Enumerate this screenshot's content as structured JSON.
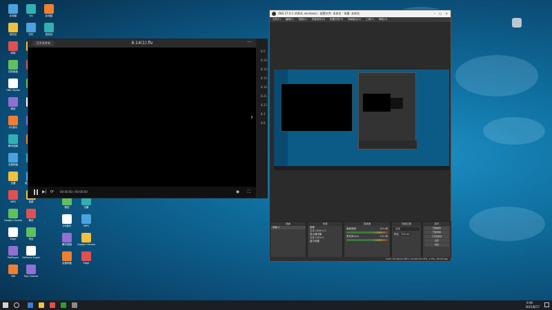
{
  "player": {
    "tab_label": "打开文件夹",
    "title": "8.14(1).flv",
    "time": "00:00:00 / 00:00:00",
    "side_list": [
      "8.5",
      "8.14",
      "8.14",
      "8.15",
      "8.16",
      "8.21",
      "8.22",
      "8.3",
      "8.6"
    ]
  },
  "obs": {
    "title": "OBS 27.0.1 (64bit, windows) - 配置文件: 未命名 - 场景: 未命名",
    "menu": [
      "文件(F)",
      "编辑(E)",
      "视图(V)",
      "停靠部件(D)",
      "配置文件(P)",
      "场景集合(S)",
      "工具(T)",
      "帮助(H)"
    ],
    "scenes_header": "场景",
    "scene_item": "场景 2",
    "sources_header": "来源",
    "sources": [
      "图像",
      "文本 (GDI+) 2",
      "显示器采集",
      "文本 (GDI+)",
      "窗口采集"
    ],
    "mixer_header": "混音器",
    "mixer": [
      {
        "name": "桌面音频",
        "db": "0.0 dB"
      },
      {
        "name": "麦克风/Aux",
        "db": "0.0 dB"
      }
    ],
    "transition_header": "场景过渡",
    "transition_type": "淡出",
    "duration_label": "时长",
    "duration_value": "300 ms",
    "controls_header": "控件",
    "controls": [
      "开始推流",
      "开始录制",
      "工作室模式",
      "设置",
      "退出"
    ],
    "status": "LIVE: 00:00:00   REC: 00:00:00   CPU: 2.9%, 60.00 fps"
  },
  "desktop_icons": [
    "此电脑",
    "回收站",
    "网络",
    "控制面板",
    "OBS Studio",
    "微信",
    "QQ音乐",
    "腾讯视频",
    "百度网盘",
    "迅雷",
    "WPS",
    "Google Chrome",
    "Edge",
    "PotPlayer",
    "360",
    "QQ",
    "钉钉",
    "Steam",
    "文档",
    "图片",
    "视频",
    "下载",
    "音乐",
    "桌面",
    "新建文件夹",
    "录屏",
    "素材",
    "项目",
    "GeForce Experience",
    "Epic Games"
  ],
  "taskbar": {
    "time": "0:46",
    "date": "2021/8/17"
  },
  "colors": {
    "desktop": "#0f6f9f",
    "obs_bg": "#2b2b2b",
    "player_bg": "#000000",
    "taskbar": "#1b1e23"
  }
}
